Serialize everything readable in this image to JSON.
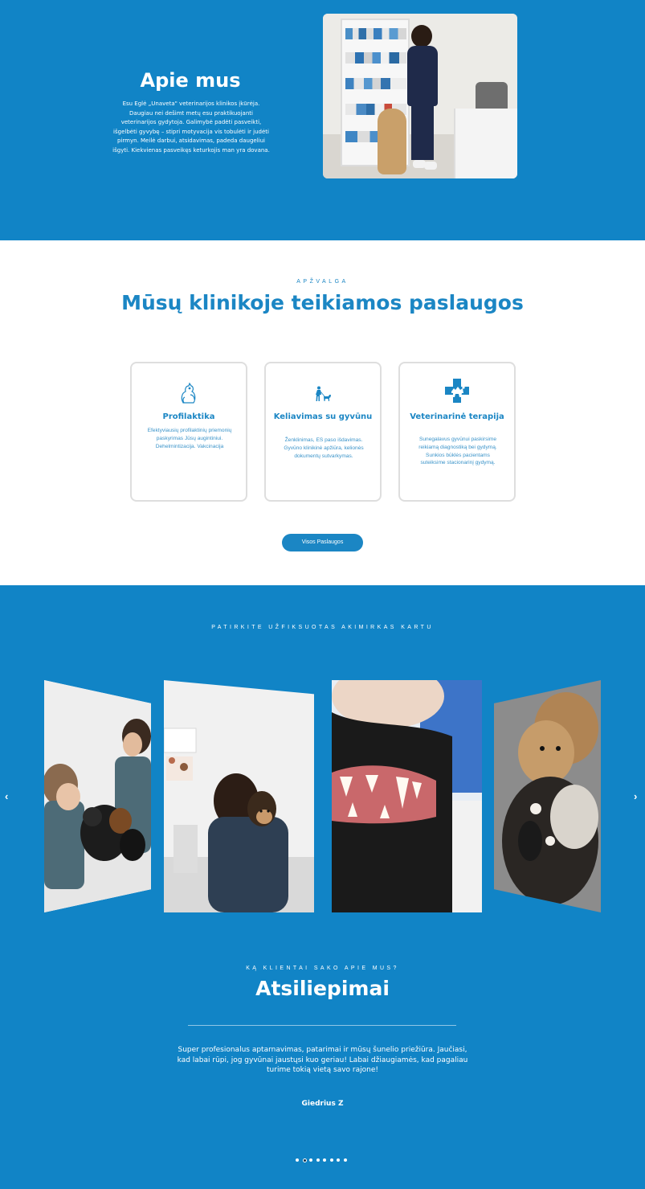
{
  "about": {
    "title": "Apie mus",
    "text": "Esu Eglė „Unaveta\" veterinarijos klinikos įkūrėja. Daugiau nei dešimt metų esu praktikuojanti veterinarijos gydytoja. Galimybė padėti pasveikti, išgelbėti gyvybę – stipri motyvacija vis tobulėti ir judėti pirmyn. Meilė darbui, atsidavimas, padeda daugeliui išgyti. Kiekvienas pasveikęs keturkojis man yra dovana.",
    "photo_icon": "vet-with-dog-photo"
  },
  "services": {
    "kicker": "APŽVALGA",
    "title": "Mūsų klinikoje teikiamos paslaugos",
    "cards": [
      {
        "icon": "pets-icon",
        "title": "Profilaktika",
        "text": "Efektyviausių profilaktinių priemonių paskyrimas Jūsų augintiniui. Dehelmintizacija. Vakcinacija"
      },
      {
        "icon": "walking-dog-icon",
        "title": "Keliavimas su gyvūnu",
        "text": "Ženklinimas, ES paso išdavimas. Gyvūno klinikinė apžiūra, kelionės dokumentų sutvarkymas."
      },
      {
        "icon": "medical-cross-icon",
        "title": "Veterinarinė terapija",
        "text": "Sunegalavus gyvūnui paskirsime reikiamą diagnostiką bei gydymą. Sunkios būklės pacientams suteiksime stacionarinį gydymą."
      }
    ],
    "button_label": "Visos Paslaugos"
  },
  "gallery": {
    "kicker": "PATIRKITE UŽFIKSUOTAS AKIMIRKAS KARTU",
    "prev_icon": "chevron-left-icon",
    "next_icon": "chevron-right-icon",
    "prev_glyph": "‹",
    "next_glyph": "›"
  },
  "testimonials": {
    "kicker": "KĄ KLIENTAI SAKO APIE MUS?",
    "title": "Atsiliepimai",
    "quote": "Super profesionalus aptarnavimas, patarimai ir mūsų šunelio priežiūra. Jaučiasi, kad labai rūpi, jog gyvūnai jaustųsi kuo geriau! Labai džiaugiamės, kad pagaliau turime tokią vietą savo rajone!",
    "author": "Giedrius Z",
    "dot_count": 8,
    "active_dot": 1
  },
  "colors": {
    "brand_blue": "#1184c6",
    "heading_blue": "#1b86c4",
    "white": "#ffffff"
  }
}
